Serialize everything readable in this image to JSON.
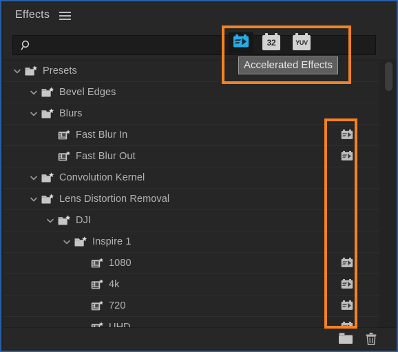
{
  "panel": {
    "title": "Effects",
    "menu_icon": "hamburger-menu-icon"
  },
  "search": {
    "value": "",
    "placeholder": "",
    "icon": "search-icon"
  },
  "quality_toolbar": {
    "buttons": [
      {
        "name": "accelerated-effects-toggle",
        "icon": "accelerated-effects-icon",
        "label": "",
        "pressed": true
      },
      {
        "name": "32-bit-color-toggle",
        "icon": "32-bit-badge-icon",
        "label": "32",
        "pressed": false
      },
      {
        "name": "yuv-effects-toggle",
        "icon": "yuv-badge-icon",
        "label": "YUV",
        "pressed": false
      }
    ]
  },
  "tooltip": {
    "text": "Accelerated Effects"
  },
  "tree": {
    "rows": [
      {
        "label": "Presets",
        "depth": 0,
        "type": "folder",
        "expanded": true,
        "accelerated": false
      },
      {
        "label": "Bevel Edges",
        "depth": 1,
        "type": "folder",
        "expanded": true,
        "accelerated": false
      },
      {
        "label": "Blurs",
        "depth": 1,
        "type": "folder",
        "expanded": true,
        "accelerated": false
      },
      {
        "label": "Fast Blur In",
        "depth": 2,
        "type": "preset",
        "expanded": null,
        "accelerated": true
      },
      {
        "label": "Fast Blur Out",
        "depth": 2,
        "type": "preset",
        "expanded": null,
        "accelerated": true
      },
      {
        "label": "Convolution Kernel",
        "depth": 1,
        "type": "folder",
        "expanded": true,
        "accelerated": false
      },
      {
        "label": "Lens Distortion Removal",
        "depth": 1,
        "type": "folder",
        "expanded": true,
        "accelerated": false
      },
      {
        "label": "DJI",
        "depth": 2,
        "type": "folder",
        "expanded": true,
        "accelerated": false
      },
      {
        "label": "Inspire 1",
        "depth": 3,
        "type": "folder",
        "expanded": true,
        "accelerated": false
      },
      {
        "label": "1080",
        "depth": 4,
        "type": "preset",
        "expanded": null,
        "accelerated": true
      },
      {
        "label": "4k",
        "depth": 4,
        "type": "preset",
        "expanded": null,
        "accelerated": true
      },
      {
        "label": "720",
        "depth": 4,
        "type": "preset",
        "expanded": null,
        "accelerated": true
      },
      {
        "label": "UHD",
        "depth": 4,
        "type": "preset",
        "expanded": null,
        "accelerated": true
      }
    ]
  },
  "bottom_bar": {
    "new_bin_label": "",
    "delete_label": "",
    "new_bin_icon": "new-custom-bin-icon",
    "delete_icon": "trash-icon"
  },
  "scrollbar": {
    "orientation": "vertical"
  },
  "colors": {
    "panel_background": "#262626",
    "header_background": "#272727",
    "panel_border": "#2a5fa8",
    "accent_highlight": "#f58220",
    "accelerated_icon_active": "#29abe2",
    "text": "#b3b3b3",
    "tooltip_background": "#5e5e5e"
  },
  "annotations": [
    {
      "name": "highlight-quality-toolbar",
      "color": "#f58220"
    },
    {
      "name": "highlight-accelerated-column",
      "color": "#f58220"
    }
  ]
}
